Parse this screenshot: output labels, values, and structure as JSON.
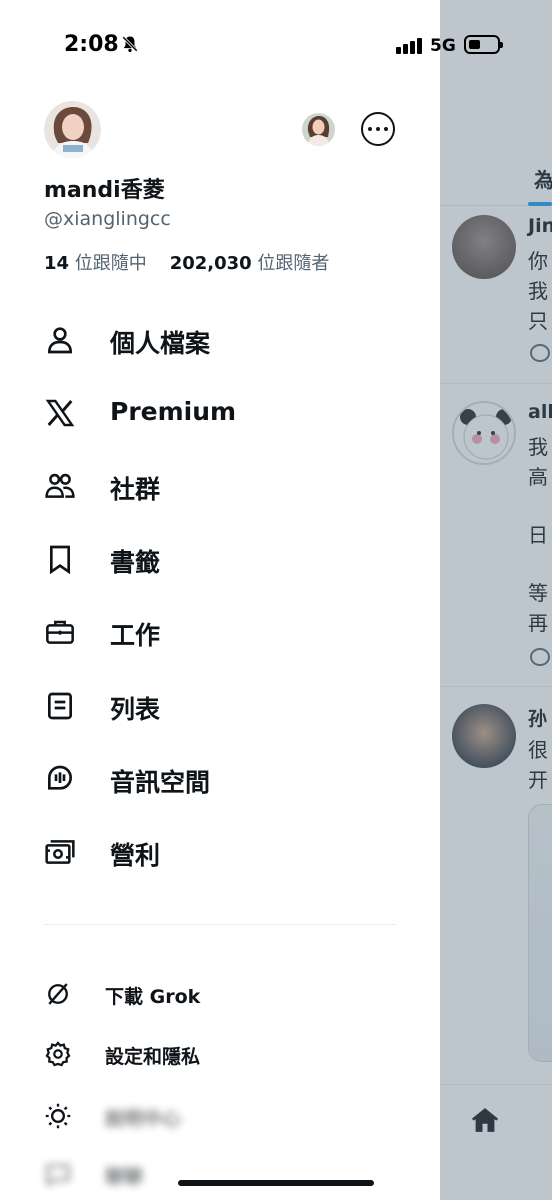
{
  "status_bar": {
    "time": "2:08",
    "network": "5G"
  },
  "profile": {
    "display_name": "mandi香菱",
    "handle": "@xianglingcc",
    "following_count": "14",
    "following_label": "位跟隨中",
    "followers_count": "202,030",
    "followers_label": "位跟隨者"
  },
  "menu": [
    {
      "label": "個人檔案",
      "icon": "person-icon"
    },
    {
      "label": "Premium",
      "icon": "x-logo-icon"
    },
    {
      "label": "社群",
      "icon": "communities-icon"
    },
    {
      "label": "書籤",
      "icon": "bookmark-icon"
    },
    {
      "label": "工作",
      "icon": "briefcase-icon"
    },
    {
      "label": "列表",
      "icon": "list-icon"
    },
    {
      "label": "音訊空間",
      "icon": "spaces-icon"
    },
    {
      "label": "營利",
      "icon": "monetization-icon"
    }
  ],
  "secondary_menu": [
    {
      "label": "下載 Grok",
      "icon": "grok-icon"
    },
    {
      "label": "設定和隱私",
      "icon": "gear-icon"
    },
    {
      "label": "說明中心",
      "icon": "sun-icon"
    },
    {
      "label": "聊聊",
      "icon": "message-icon"
    }
  ],
  "feed": {
    "tab_label": "為",
    "posts": [
      {
        "name": "Jin",
        "lines": [
          "你",
          "我",
          "只"
        ]
      },
      {
        "name": "all",
        "lines": [
          "我",
          "高",
          "日",
          "等",
          "再"
        ]
      },
      {
        "name": "孙",
        "lines": [
          "很",
          "开"
        ]
      }
    ]
  },
  "colors": {
    "accent": "#1d9bf0",
    "text": "#0f1419",
    "muted": "#536471"
  }
}
